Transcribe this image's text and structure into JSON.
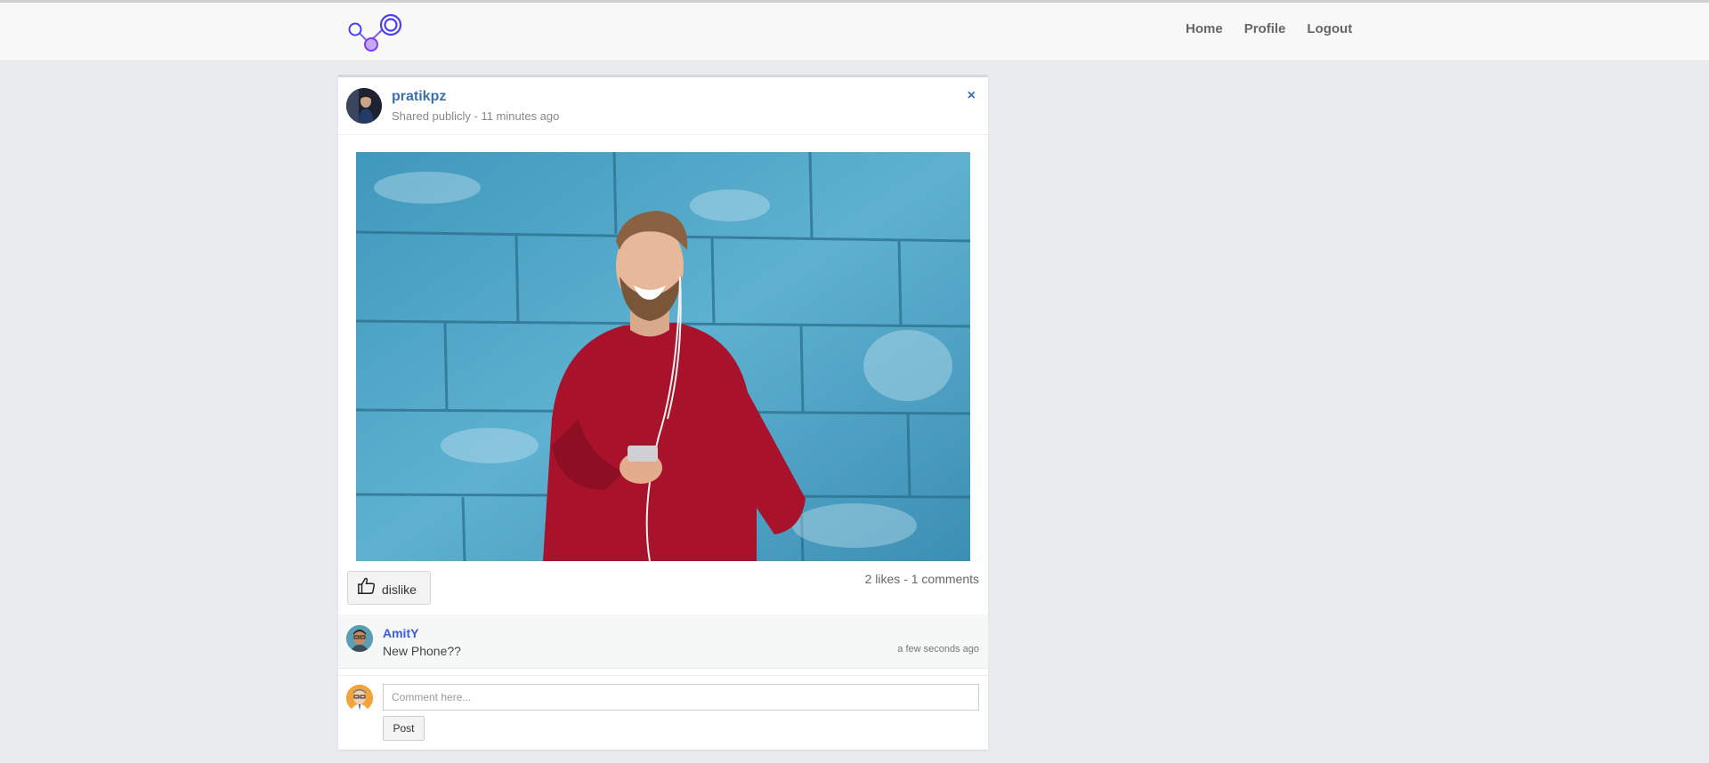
{
  "navbar": {
    "logo": "network-logo",
    "links": [
      {
        "label": "Home"
      },
      {
        "label": "Profile"
      },
      {
        "label": "Logout"
      }
    ]
  },
  "post": {
    "author": "pratikpz",
    "visibility": "Shared publicly - 11 minutes ago",
    "close_symbol": "×",
    "image_alt": "man in red sweater with earphones against blue wall",
    "like_button_label": "dislike",
    "stats": "2 likes - 1 comments",
    "comments": [
      {
        "author": "AmitY",
        "text": "New Phone??",
        "time": "a few seconds ago"
      }
    ],
    "comment_placeholder": "Comment here...",
    "post_button": "Post"
  },
  "colors": {
    "link": "#3a6fb0",
    "comment_author": "#3b5bdb",
    "logo_accent": "#4b3df0"
  }
}
